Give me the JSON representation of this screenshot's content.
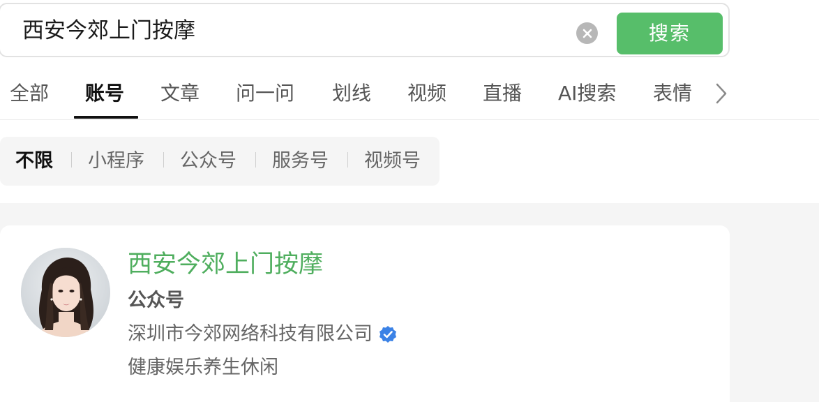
{
  "search": {
    "query": "西安今郊上门按摩",
    "button_label": "搜索",
    "clear_icon": "close-icon"
  },
  "tabs": {
    "items": [
      {
        "label": "全部",
        "active": false
      },
      {
        "label": "账号",
        "active": true
      },
      {
        "label": "文章",
        "active": false
      },
      {
        "label": "问一问",
        "active": false
      },
      {
        "label": "划线",
        "active": false
      },
      {
        "label": "视频",
        "active": false
      },
      {
        "label": "直播",
        "active": false
      },
      {
        "label": "AI搜索",
        "active": false
      },
      {
        "label": "表情",
        "active": false
      }
    ],
    "more_icon": "chevron-right-icon"
  },
  "filters": {
    "items": [
      {
        "label": "不限",
        "active": true
      },
      {
        "label": "小程序",
        "active": false
      },
      {
        "label": "公众号",
        "active": false
      },
      {
        "label": "服务号",
        "active": false
      },
      {
        "label": "视频号",
        "active": false
      }
    ]
  },
  "result": {
    "name": "西安今郊上门按摩",
    "type": "公众号",
    "company": "深圳市今郊网络科技有限公司",
    "verified_icon": "verified-badge-icon",
    "description": "健康娱乐养生休闲"
  },
  "colors": {
    "accent_green": "#57be6a",
    "name_green": "#4fae5e",
    "verified_blue": "#3b82e6",
    "panel_gray": "#f5f5f5"
  }
}
